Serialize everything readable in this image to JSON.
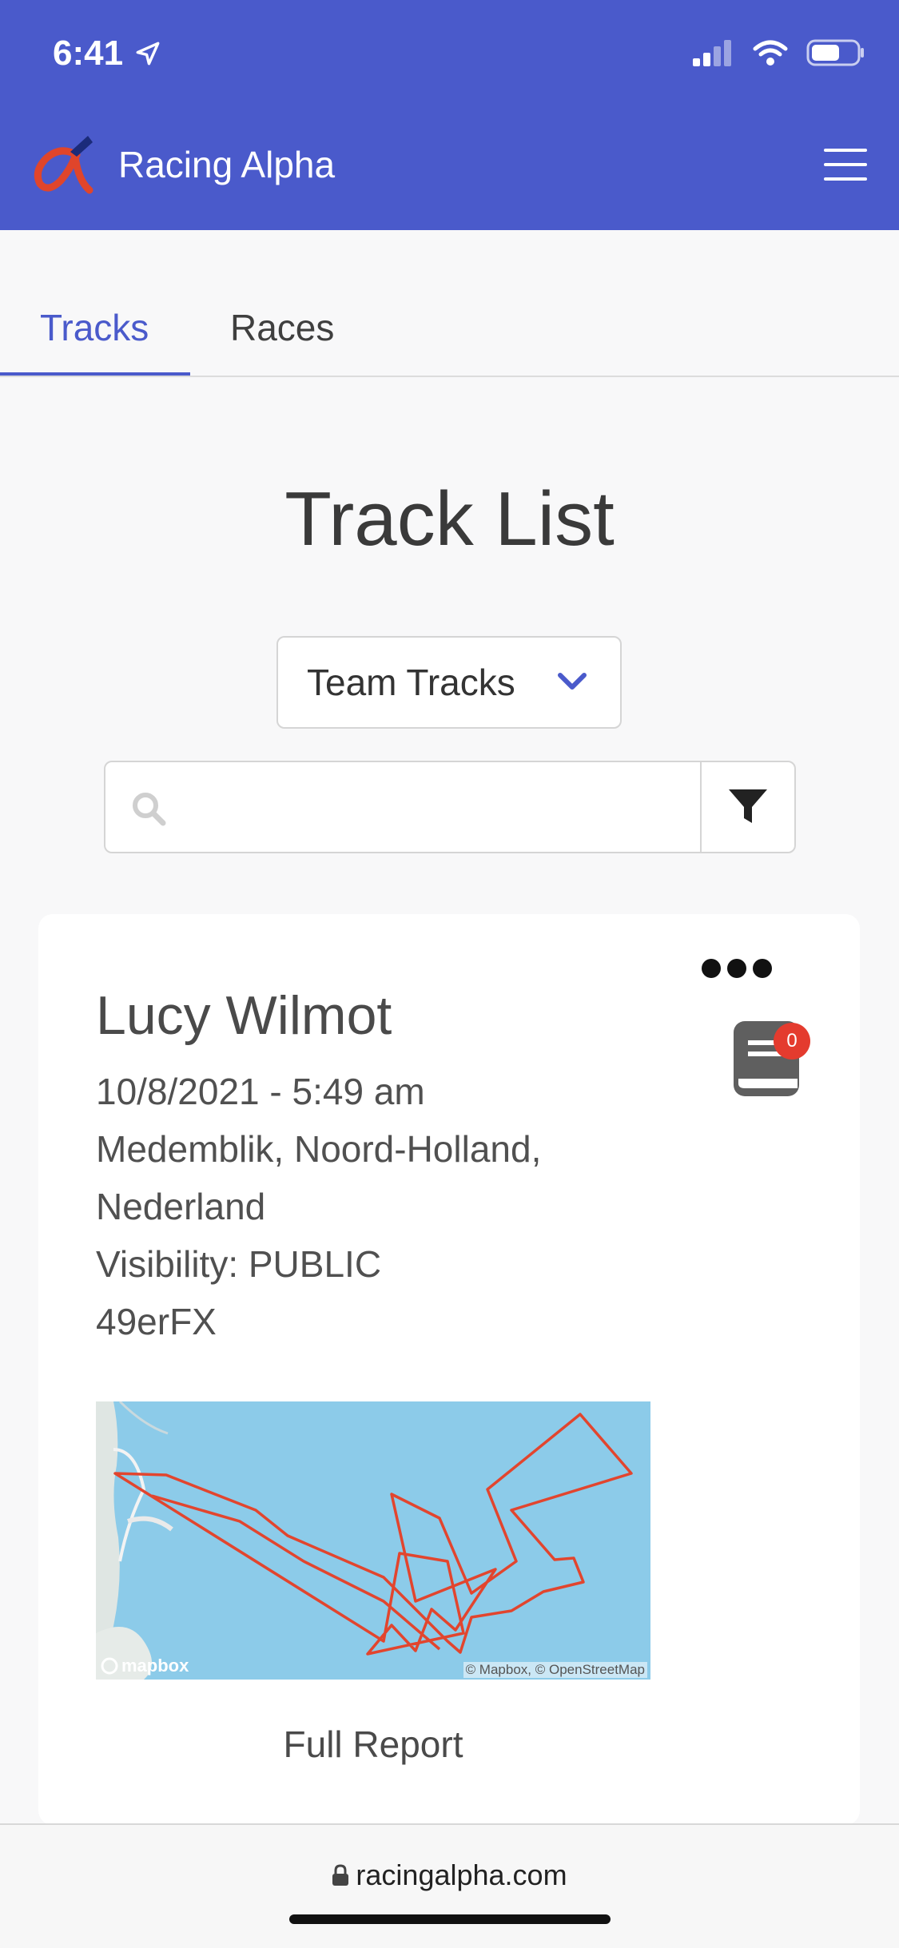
{
  "status_bar": {
    "time": "6:41"
  },
  "header": {
    "app_title": "Racing Alpha",
    "brand_color": "#4a5acb"
  },
  "tabs": [
    {
      "label": "Tracks",
      "active": true
    },
    {
      "label": "Races",
      "active": false
    }
  ],
  "page": {
    "title": "Track List"
  },
  "filter": {
    "selected": "Team Tracks"
  },
  "search": {
    "placeholder": "",
    "value": ""
  },
  "track": {
    "owner": "Lucy Wilmot",
    "datetime": "10/8/2021 - 5:49 am",
    "location_line1": "Medemblik, Noord-Holland,",
    "location_line2": "Nederland",
    "visibility": "Visibility: PUBLIC",
    "boat_class": "49erFX",
    "notes_count": "0",
    "map_logo": "mapbox",
    "map_credit": "© Mapbox, © OpenStreetMap",
    "full_report": "Full Report"
  },
  "browser": {
    "url": "racingalpha.com"
  },
  "icons": [
    "location-arrow-icon",
    "signal-icon",
    "wifi-icon",
    "battery-icon",
    "logo-icon",
    "menu-icon",
    "chevron-down-icon",
    "search-icon",
    "filter-icon",
    "more-icon",
    "notebook-icon",
    "lock-icon"
  ]
}
